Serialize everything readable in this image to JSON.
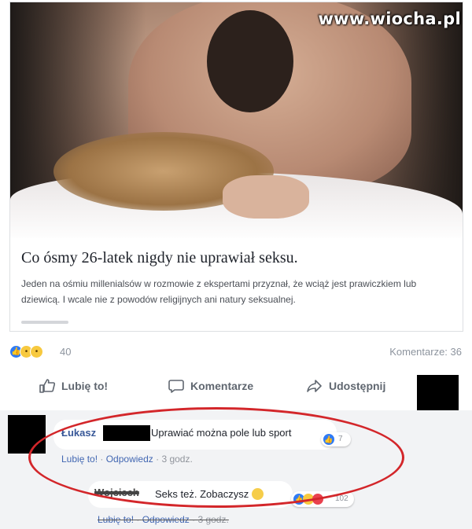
{
  "watermark": "www.wiocha.pl",
  "article": {
    "title": "Co ósmy 26-latek nigdy nie uprawiał seksu.",
    "description": "Jeden na ośmiu millenialsów w rozmowie z ekspertami przyznał, że wciąż jest prawiczkiem lub dziewicą. I wcale nie z powodów religijnych ani natury seksualnej."
  },
  "reactions": {
    "icons": [
      "like-icon",
      "wow-icon",
      "haha-icon"
    ],
    "count": "40",
    "comments_label": "Komentarze: 36"
  },
  "actions": {
    "like": "Lubię to!",
    "comment": "Komentarze",
    "share": "Udostępnij"
  },
  "comments": [
    {
      "author": "Łukasz",
      "text": "Uprawiać można pole lub sport",
      "reaction_count": "7",
      "like_label": "Lubię to!",
      "reply_label": "Odpowiedz",
      "time": "3 godz."
    },
    {
      "author": "Wojciech",
      "text": "Seks też. Zobaczysz",
      "reaction_count": "102",
      "like_label": "Lubię to!",
      "reply_label": "Odpowiedz",
      "time": "3 godz."
    }
  ],
  "colors": {
    "link": "#4267b2",
    "annotation_circle": "#d3262a",
    "like_blue": "#2f7bf5"
  }
}
